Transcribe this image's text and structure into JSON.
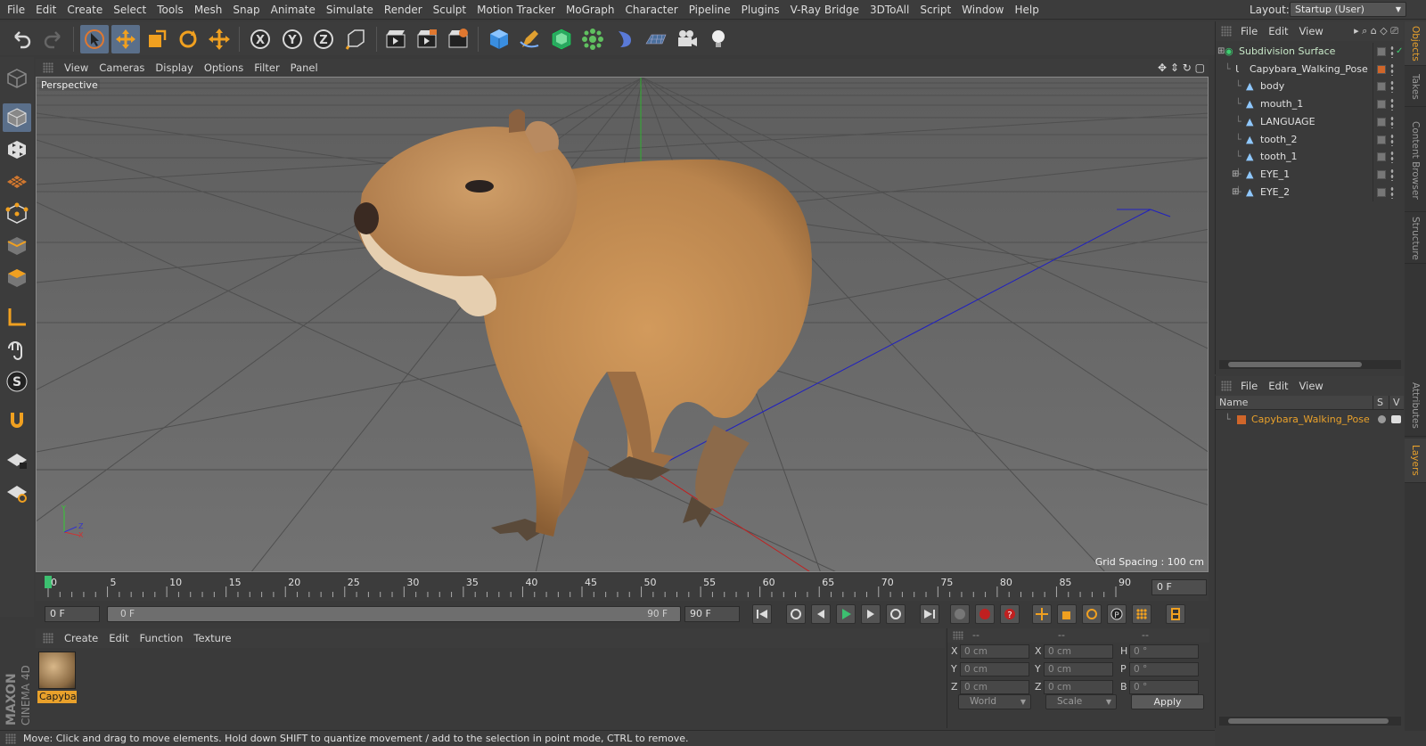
{
  "menubar": {
    "items": [
      "File",
      "Edit",
      "Create",
      "Select",
      "Tools",
      "Mesh",
      "Snap",
      "Animate",
      "Simulate",
      "Render",
      "Sculpt",
      "Motion Tracker",
      "MoGraph",
      "Character",
      "Pipeline",
      "Plugins",
      "V-Ray Bridge",
      "3DToAll",
      "Script",
      "Window",
      "Help"
    ],
    "layout_label": "Layout:",
    "layout_value": "Startup (User)"
  },
  "toolbar": {
    "icons": [
      "undo-icon",
      "redo-icon",
      "select-arrow-icon",
      "move-icon",
      "scale-icon",
      "rotate-icon",
      "live-select-icon",
      "x-axis-icon",
      "y-axis-icon",
      "z-axis-icon",
      "coordinate-system-icon",
      "render-view-icon",
      "render-picture-viewer-icon",
      "render-settings-icon",
      "cube-icon",
      "pen-icon",
      "subdivision-icon",
      "cloner-icon",
      "deformer-icon",
      "floor-icon",
      "camera-icon",
      "light-icon"
    ],
    "axis_x": "X",
    "axis_y": "Y",
    "axis_z": "Z"
  },
  "viewport": {
    "menu": [
      "View",
      "Cameras",
      "Display",
      "Options",
      "Filter",
      "Panel"
    ],
    "label": "Perspective",
    "grid_spacing": "Grid Spacing : 100 cm",
    "background": "#6f6f6f"
  },
  "timeline": {
    "ticks": [
      "0",
      "5",
      "10",
      "15",
      "20",
      "25",
      "30",
      "35",
      "40",
      "45",
      "50",
      "55",
      "60",
      "65",
      "70",
      "75",
      "80",
      "85",
      "90"
    ],
    "current_frame": "0 F"
  },
  "transport": {
    "start_field": "0 F",
    "slider_left": "0 F",
    "slider_right": "90 F",
    "end_field": "90 F"
  },
  "materials": {
    "menu": [
      "Create",
      "Edit",
      "Function",
      "Texture"
    ],
    "items": [
      {
        "label": "Capybar"
      }
    ]
  },
  "coordinates": {
    "header": [
      "--",
      "--",
      "--"
    ],
    "rows": [
      {
        "l1": "X",
        "v1": "0 cm",
        "l2": "X",
        "v2": "0 cm",
        "l3": "H",
        "v3": "0 °"
      },
      {
        "l1": "Y",
        "v1": "0 cm",
        "l2": "Y",
        "v2": "0 cm",
        "l3": "P",
        "v3": "0 °"
      },
      {
        "l1": "Z",
        "v1": "0 cm",
        "l2": "Z",
        "v2": "0 cm",
        "l3": "B",
        "v3": "0 °"
      }
    ],
    "space": "World",
    "mode": "Scale",
    "apply": "Apply"
  },
  "status": {
    "text": "Move: Click and drag to move elements. Hold down SHIFT to quantize movement / add to the selection in point mode, CTRL to remove."
  },
  "logo": {
    "maxon": "MAXON",
    "product": "CINEMA 4D"
  },
  "object_manager": {
    "menu": [
      "File",
      "Edit",
      "View"
    ],
    "objects": [
      {
        "name": "Subdivision Surface",
        "indent": 0,
        "color": "#c8e8c8"
      },
      {
        "name": "Capybara_Walking_Pose",
        "indent": 1,
        "color": "#e0e0e0"
      },
      {
        "name": "body",
        "indent": 2,
        "color": "#e0e0e0"
      },
      {
        "name": "mouth_1",
        "indent": 2,
        "color": "#e0e0e0"
      },
      {
        "name": "LANGUAGE",
        "indent": 2,
        "color": "#e0e0e0"
      },
      {
        "name": "tooth_2",
        "indent": 2,
        "color": "#e0e0e0"
      },
      {
        "name": "tooth_1",
        "indent": 2,
        "color": "#e0e0e0"
      },
      {
        "name": "EYE_1",
        "indent": 2,
        "color": "#e0e0e0"
      },
      {
        "name": "EYE_2",
        "indent": 2,
        "color": "#e0e0e0"
      }
    ]
  },
  "layer_manager": {
    "menu": [
      "File",
      "Edit",
      "View"
    ],
    "col_name": "Name",
    "col_s": "S",
    "col_v": "V",
    "layers": [
      {
        "name": "Capybara_Walking_Pose",
        "color": "#d0662a"
      }
    ]
  },
  "right_tabs": [
    "Objects",
    "Takes",
    "Content Browser",
    "Structure",
    "Attributes",
    "Layers"
  ],
  "colors": {
    "accent": "#e9a12b",
    "layer_orange": "#d0662a"
  }
}
